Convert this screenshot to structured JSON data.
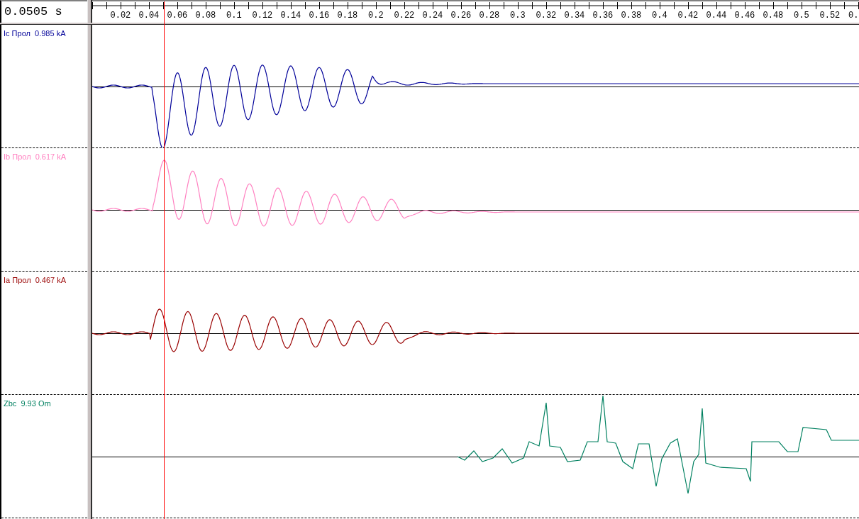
{
  "cursor_readout": "0.0505 s",
  "ruler": {
    "labels": [
      "0.02",
      "0.04",
      "0.06",
      "0.08",
      "0.1",
      "0.12",
      "0.14",
      "0.16",
      "0.18",
      "0.2",
      "0.22",
      "0.24",
      "0.26",
      "0.28",
      "0.3",
      "0.32",
      "0.34",
      "0.36",
      "0.38",
      "0.4",
      "0.42",
      "0.44",
      "0.46",
      "0.48",
      "0.5",
      "0.52",
      "0."
    ]
  },
  "channels": [
    {
      "label": "Ic Прол  0.985 kA",
      "color": "#000099"
    },
    {
      "label": "Ib Прол  0.617 kA",
      "color": "#ff80c0"
    },
    {
      "label": "Ia Прол  0.467 kA",
      "color": "#990000"
    },
    {
      "label": "Zbc  9.93 Om",
      "color": "#008060"
    }
  ]
}
